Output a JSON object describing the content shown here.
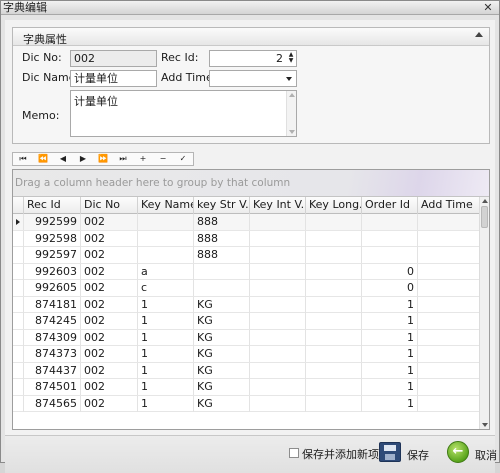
{
  "window": {
    "title": "字典编辑",
    "close_label": "✕"
  },
  "props": {
    "group_title": "字典属性",
    "dic_no_label": "Dic No:",
    "dic_no_value": "002",
    "rec_id_label": "Rec Id:",
    "rec_id_value": "2",
    "dic_name_label": "Dic Name:",
    "dic_name_value": "计量单位",
    "add_time_label": "Add Time:",
    "add_time_value": "",
    "memo_label": "Memo:",
    "memo_value": "计量单位"
  },
  "navigator": {
    "buttons": [
      "⏮",
      "⏪",
      "◀",
      "▶",
      "⏩",
      "⏭",
      "+",
      "−",
      "✓"
    ]
  },
  "grid": {
    "group_hint": "Drag a column header here to group by that column",
    "columns": [
      "Rec Id",
      "Dic No",
      "Key Name",
      "key Str V...",
      "Key Int V...",
      "Key Long...",
      "Order Id",
      "Add Time"
    ],
    "rows": [
      {
        "rec_id": "992599",
        "dic_no": "002",
        "key_name": "",
        "key_str": "888",
        "key_int": "",
        "key_long": "",
        "order_id": "",
        "add_time": ""
      },
      {
        "rec_id": "992598",
        "dic_no": "002",
        "key_name": "",
        "key_str": "888",
        "key_int": "",
        "key_long": "",
        "order_id": "",
        "add_time": ""
      },
      {
        "rec_id": "992597",
        "dic_no": "002",
        "key_name": "",
        "key_str": "888",
        "key_int": "",
        "key_long": "",
        "order_id": "",
        "add_time": ""
      },
      {
        "rec_id": "992603",
        "dic_no": "002",
        "key_name": "a",
        "key_str": "",
        "key_int": "",
        "key_long": "",
        "order_id": "0",
        "add_time": ""
      },
      {
        "rec_id": "992605",
        "dic_no": "002",
        "key_name": "c",
        "key_str": "",
        "key_int": "",
        "key_long": "",
        "order_id": "0",
        "add_time": ""
      },
      {
        "rec_id": "874181",
        "dic_no": "002",
        "key_name": "1",
        "key_str": "KG",
        "key_int": "",
        "key_long": "",
        "order_id": "1",
        "add_time": ""
      },
      {
        "rec_id": "874245",
        "dic_no": "002",
        "key_name": "1",
        "key_str": "KG",
        "key_int": "",
        "key_long": "",
        "order_id": "1",
        "add_time": ""
      },
      {
        "rec_id": "874309",
        "dic_no": "002",
        "key_name": "1",
        "key_str": "KG",
        "key_int": "",
        "key_long": "",
        "order_id": "1",
        "add_time": ""
      },
      {
        "rec_id": "874373",
        "dic_no": "002",
        "key_name": "1",
        "key_str": "KG",
        "key_int": "",
        "key_long": "",
        "order_id": "1",
        "add_time": ""
      },
      {
        "rec_id": "874437",
        "dic_no": "002",
        "key_name": "1",
        "key_str": "KG",
        "key_int": "",
        "key_long": "",
        "order_id": "1",
        "add_time": ""
      },
      {
        "rec_id": "874501",
        "dic_no": "002",
        "key_name": "1",
        "key_str": "KG",
        "key_int": "",
        "key_long": "",
        "order_id": "1",
        "add_time": ""
      },
      {
        "rec_id": "874565",
        "dic_no": "002",
        "key_name": "1",
        "key_str": "KG",
        "key_int": "",
        "key_long": "",
        "order_id": "1",
        "add_time": ""
      }
    ]
  },
  "footer": {
    "save_add_new_label": "保存并添加新项",
    "save_label": "保存",
    "cancel_label": "取消"
  }
}
